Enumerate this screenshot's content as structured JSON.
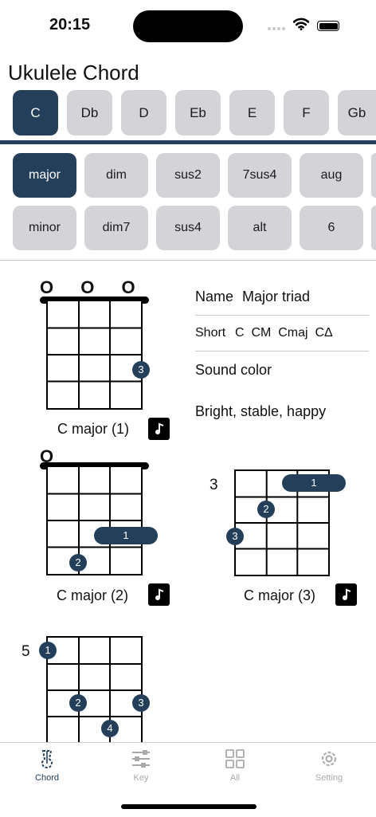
{
  "status": {
    "time": "20:15"
  },
  "app": {
    "title": "Ukulele Chord"
  },
  "keys": [
    "C",
    "Db",
    "D",
    "Eb",
    "E",
    "F",
    "Gb"
  ],
  "selected_key": "C",
  "qualities_row1": [
    "major",
    "dim",
    "sus2",
    "7sus4",
    "aug"
  ],
  "qualities_row2": [
    "minor",
    "dim7",
    "sus4",
    "alt",
    "6"
  ],
  "selected_quality": "major",
  "info": {
    "name_label": "Name",
    "name_value": "Major triad",
    "short_label": "Short",
    "short_values": "C  CM  Cmaj  CΔ",
    "sound_color_label": "Sound color",
    "sound_color_value": "Bright, stable, happy"
  },
  "diagrams": [
    {
      "label": "C major (1)",
      "open_mark": "O O O",
      "fret_label": "",
      "dots": [
        "3"
      ]
    },
    {
      "label": "C major (2)",
      "open_mark": "O",
      "fret_label": "",
      "dots": [
        "1",
        "2"
      ]
    },
    {
      "label": "C major (3)",
      "open_mark": "",
      "fret_label": "3",
      "dots": [
        "1",
        "2",
        "3"
      ]
    },
    {
      "label": "",
      "open_mark": "",
      "fret_label": "5",
      "dots": [
        "1",
        "2",
        "3",
        "4"
      ]
    }
  ],
  "tabs": [
    {
      "label": "Chord",
      "icon": "ukulele-icon"
    },
    {
      "label": "Key",
      "icon": "sliders-icon"
    },
    {
      "label": "All",
      "icon": "grid-icon"
    },
    {
      "label": "Setting",
      "icon": "gear-icon"
    }
  ],
  "colors": {
    "accent": "#243f59",
    "button": "#d4d4d8",
    "inactive_tab": "#a9a9a9"
  }
}
